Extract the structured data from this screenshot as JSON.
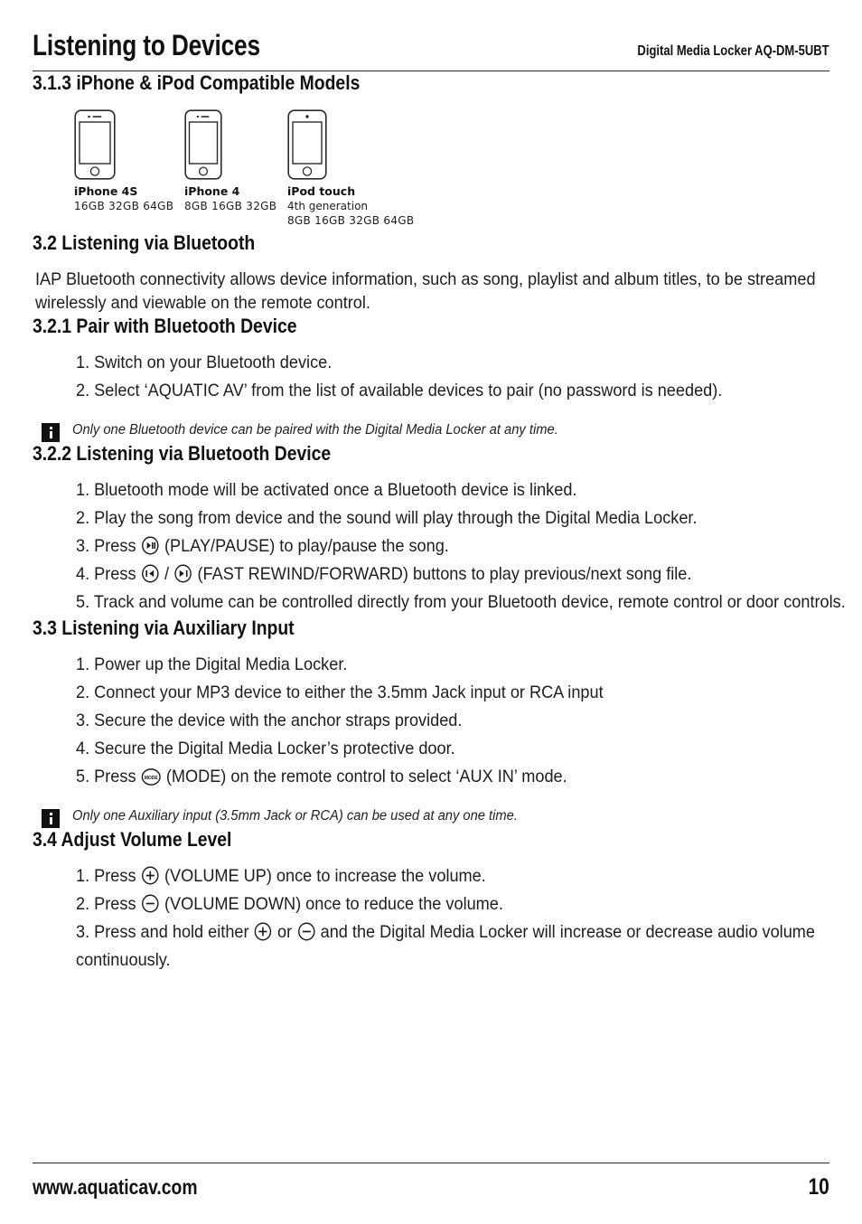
{
  "header": {
    "title": "Listening to Devices",
    "model": "Digital Media Locker AQ-DM-5UBT"
  },
  "sections": {
    "s313": {
      "heading": "3.1.3 iPhone & iPod Compatible Models",
      "devices": [
        {
          "icon": "iphone-icon",
          "name": "iPhone 4S",
          "generation": "",
          "capacities": "16GB  32GB  64GB"
        },
        {
          "icon": "iphone-icon",
          "name": "iPhone 4",
          "generation": "",
          "capacities": "8GB  16GB  32GB"
        },
        {
          "icon": "ipod-touch-icon",
          "name": "iPod touch",
          "generation": "4th generation",
          "capacities": "8GB  16GB  32GB  64GB"
        }
      ]
    },
    "s32": {
      "heading": "3.2 Listening via Bluetooth",
      "paragraph": "IAP Bluetooth connectivity allows device information, such as song, playlist and album titles, to be streamed wirelessly and viewable on the remote control."
    },
    "s321": {
      "heading": "3.2.1 Pair with Bluetooth Device",
      "steps": [
        "1. Switch on your Bluetooth device.",
        "2. Select ‘AQUATIC AV’ from the list of available devices to pair (no password is needed)."
      ],
      "note": "Only one Bluetooth device can be paired with the Digital Media Locker at any time."
    },
    "s322": {
      "heading": "3.2.2 Listening via Bluetooth Device",
      "steps": [
        {
          "text_before": "1. Bluetooth mode will be activated once a Bluetooth device is linked.",
          "icons": [],
          "text_after": ""
        },
        {
          "text_before": "2. Play the song from device and the sound will play through the Digital Media Locker.",
          "icons": [],
          "text_after": ""
        },
        {
          "text_before": "3. Press ",
          "icons": [
            "play-pause-icon"
          ],
          "text_after": " (PLAY/PAUSE) to play/pause the song."
        },
        {
          "text_before": "4. Press ",
          "icons": [
            "rewind-icon",
            "forward-icon"
          ],
          "separator": " / ",
          "text_after": " (FAST REWIND/FORWARD) buttons to play previous/next song file."
        },
        {
          "text_before": "5. Track and volume can be controlled directly from your Bluetooth device, remote control or door controls.",
          "icons": [],
          "text_after": ""
        }
      ]
    },
    "s33": {
      "heading": "3.3 Listening via Auxiliary Input",
      "steps": [
        {
          "text_before": "1. Power up the Digital Media Locker.",
          "icons": [],
          "text_after": ""
        },
        {
          "text_before": "2. Connect your MP3 device to either the 3.5mm Jack input or RCA input",
          "icons": [],
          "text_after": ""
        },
        {
          "text_before": "3. Secure the device with the anchor straps provided.",
          "icons": [],
          "text_after": ""
        },
        {
          "text_before": "4. Secure the Digital Media Locker’s protective door.",
          "icons": [],
          "text_after": ""
        },
        {
          "text_before": "5. Press ",
          "icons": [
            "mode-icon"
          ],
          "text_after": " (MODE) on the remote control to select ‘AUX IN’ mode."
        }
      ],
      "note": "Only one Auxiliary input (3.5mm Jack or RCA) can be used at any one time."
    },
    "s34": {
      "heading": "3.4 Adjust Volume Level",
      "steps": [
        {
          "text_before": "1. Press ",
          "icons": [
            "volume-up-icon"
          ],
          "text_after": " (VOLUME UP) once to increase the volume."
        },
        {
          "text_before": "2. Press ",
          "icons": [
            "volume-down-icon"
          ],
          "text_after": " (VOLUME DOWN) once to reduce the volume."
        },
        {
          "text_before": "3. Press and hold either ",
          "icons": [
            "volume-up-icon",
            "volume-down-icon"
          ],
          "separator": " or ",
          "text_after": " and the Digital Media Locker will increase or decrease audio volume continuously."
        }
      ]
    }
  },
  "mode_icon_label": "MODE",
  "footer": {
    "url": "www.aquaticav.com",
    "page": "10"
  }
}
